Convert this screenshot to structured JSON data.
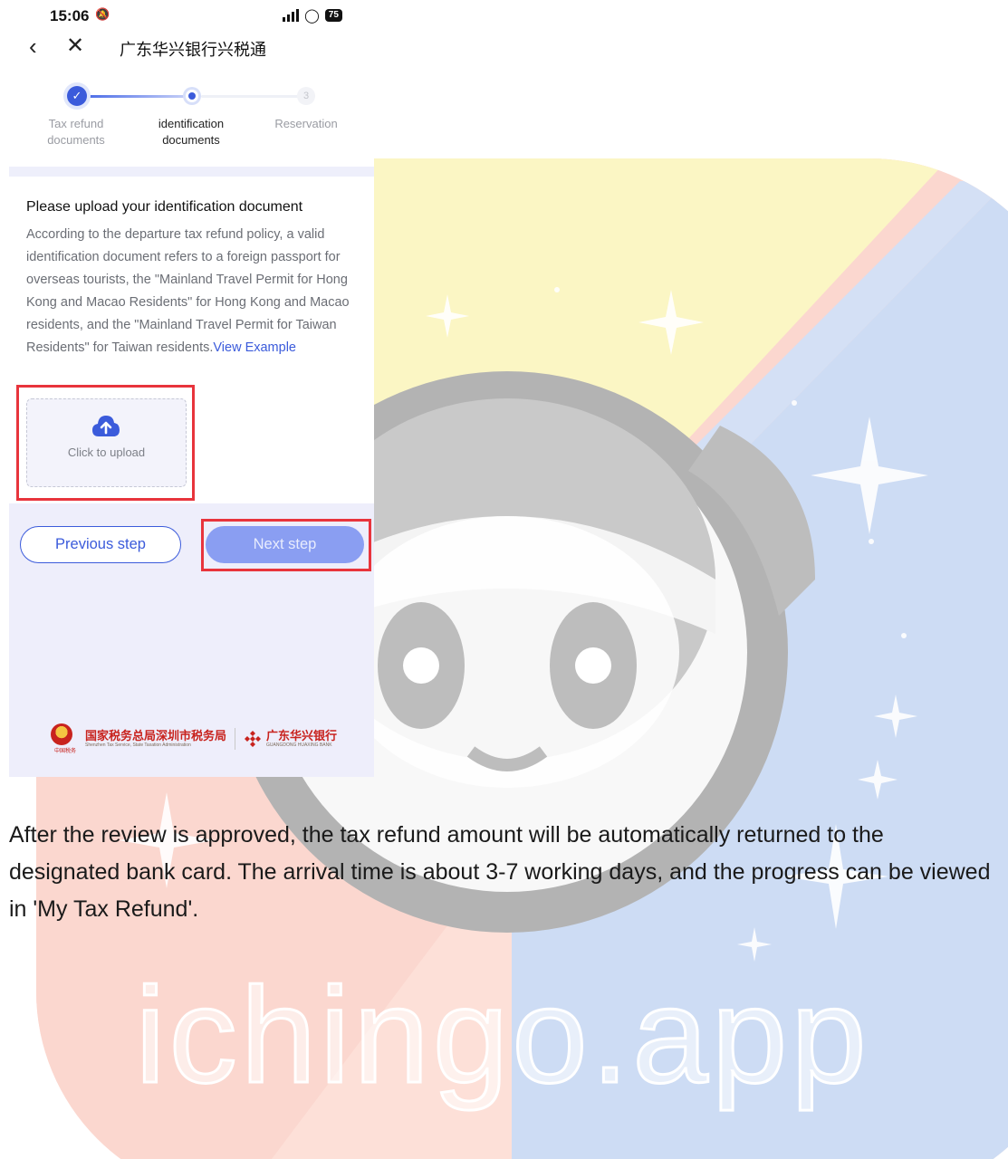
{
  "status_bar": {
    "time": "15:06",
    "battery": "75"
  },
  "nav": {
    "back_icon": "chevron-left-icon",
    "close_icon": "close-icon",
    "title": "广东华兴银行兴税通"
  },
  "steps": [
    {
      "number": "1",
      "label": "Tax refund documents",
      "state": "done"
    },
    {
      "number": "2",
      "label": "identification documents",
      "state": "current"
    },
    {
      "number": "3",
      "label": "Reservation",
      "state": "pending"
    }
  ],
  "upload_section": {
    "heading": "Please upload your identification document",
    "description": "According to the departure tax refund policy, a valid identification document refers to a foreign passport for overseas tourists, the \"Mainland Travel Permit for Hong Kong and Macao Residents\" for Hong Kong and Macao residents, and the \"Mainland Travel Permit for Taiwan Residents\" for Taiwan residents.",
    "example_link": "View Example",
    "upload_label": "Click to upload"
  },
  "buttons": {
    "previous": "Previous step",
    "next": "Next step"
  },
  "footer": {
    "tax_bureau": "国家税务总局深圳市税务局",
    "tax_bureau_en": "Shenzhen Tax Service, State Taxation Administration",
    "emblem_script": "中国税务",
    "bank": "广东华兴银行",
    "bank_en": "GUANGDONG HUAXING BANK"
  },
  "caption": "After the review is approved, the tax refund amount will be automatically returned to the designated bank card. The arrival time is about 3-7 working days, and the progress can be viewed in 'My Tax Refund'.",
  "watermark": {
    "text": "ichingo.app"
  },
  "colors": {
    "accent": "#3b5bdb",
    "highlight_box": "#e8343c",
    "next_button": "#8a9ef2"
  }
}
